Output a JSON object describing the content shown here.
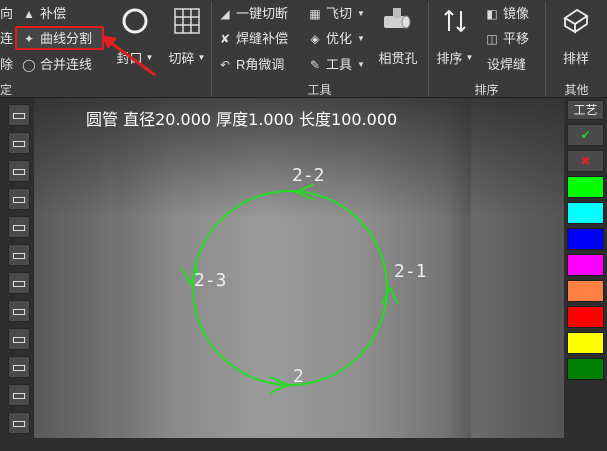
{
  "ribbon": {
    "group1": {
      "partial_left_top": "向",
      "partial_left_mid": "连",
      "partial_left_bot": "除",
      "compensate": "补偿",
      "curve_split": "曲线分割",
      "merge_lines": "合并连线",
      "seal": "封口",
      "label_partial": "定"
    },
    "group2": {
      "cut_shatter": "切碎"
    },
    "tools": {
      "one_key_cutoff": "一键切断",
      "weld_comp": "焊缝补偿",
      "r_angle": "R角微调",
      "fly_cut": "飞切",
      "optimize": "优化",
      "tools": "工具",
      "through_hole": "相贯孔",
      "label": "工具"
    },
    "sort": {
      "sort": "排序",
      "mirror": "镜像",
      "translate": "平移",
      "set_weld": "设焊缝",
      "label": "排序"
    },
    "other": {
      "layout": "排样",
      "label": "其他"
    }
  },
  "viewport": {
    "info": "圆管 直径20.000 厚度1.000 长度100.000",
    "segment_labels": [
      "2-2",
      "2-1",
      "2",
      "2-3"
    ]
  },
  "right_panel": {
    "tech_label": "工艺",
    "check_icon": "check-icon",
    "cross_icon": "cross-icon",
    "swatches": [
      "#00ff00",
      "#00ffff",
      "#0000ff",
      "#ff00ff",
      "#ff8040",
      "#ff0000",
      "#ffff00",
      "#008000"
    ]
  },
  "colors": {
    "path": "#22dd22",
    "highlight": "#e02020",
    "check": "#22cc22",
    "cross": "#dd2222"
  }
}
